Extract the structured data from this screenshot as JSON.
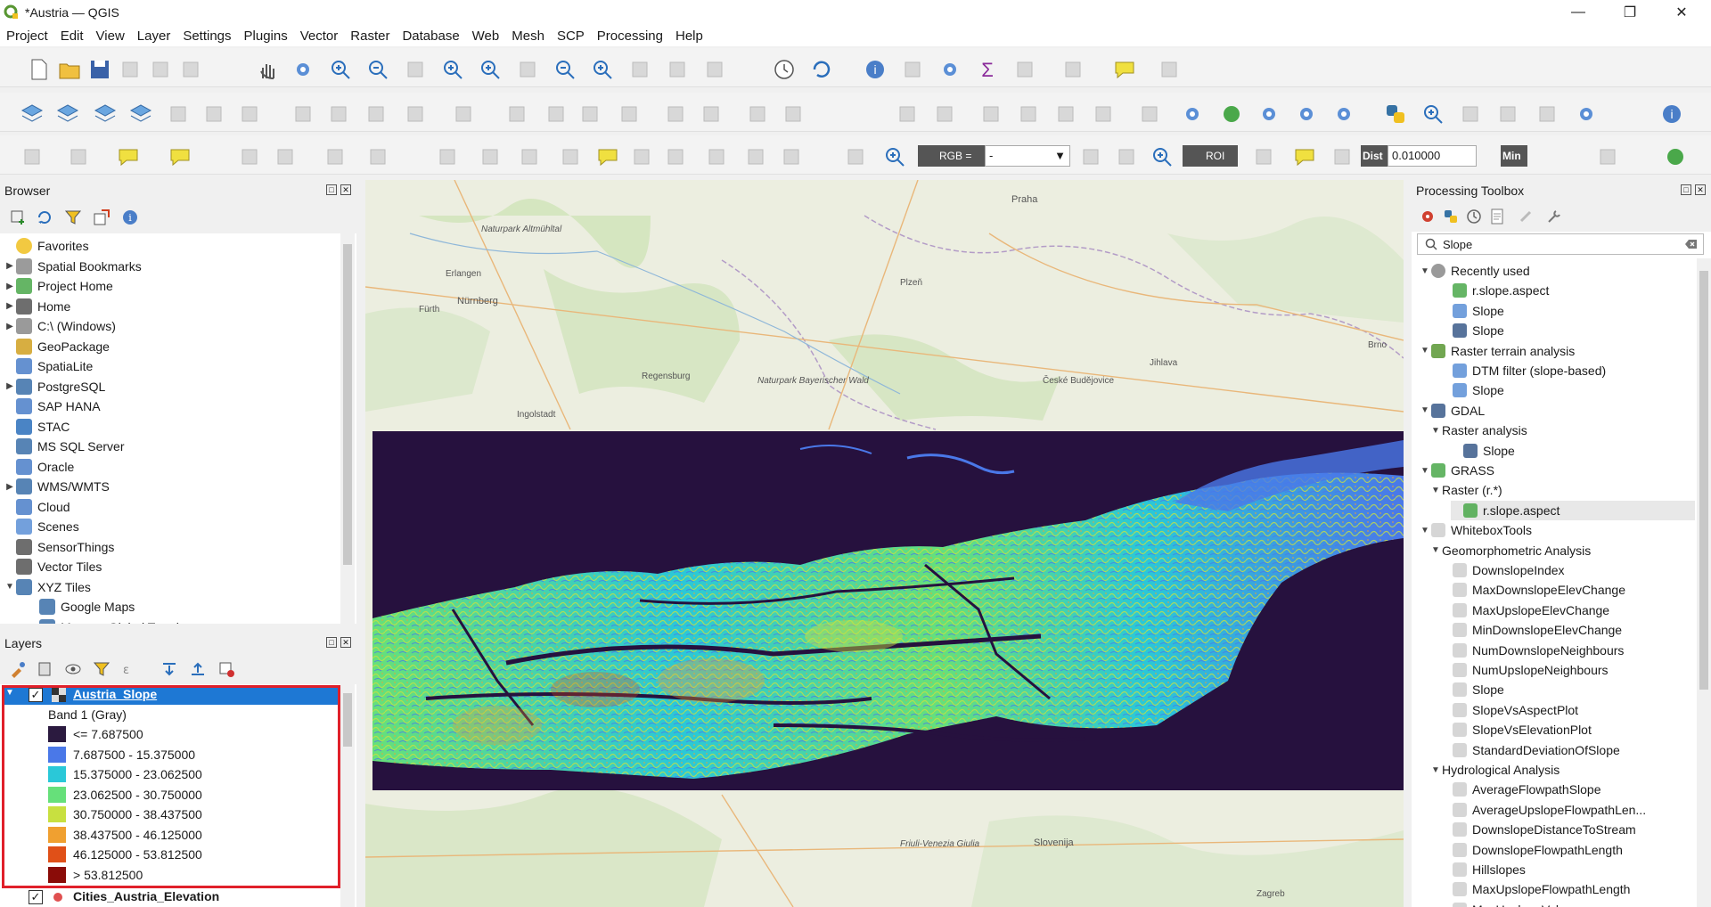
{
  "window": {
    "title": "*Austria — QGIS"
  },
  "menu": [
    "Project",
    "Edit",
    "View",
    "Layer",
    "Settings",
    "Plugins",
    "Vector",
    "Raster",
    "Database",
    "Web",
    "Mesh",
    "SCP",
    "Processing",
    "Help"
  ],
  "toolbar3": {
    "rgb_label": "RGB =",
    "rgb_value": "-",
    "roi_label": "ROI",
    "dist_label": "Dist",
    "dist_value": "0.010000",
    "min_label": "Min"
  },
  "browser": {
    "title": "Browser",
    "items": [
      {
        "label": "Favorites",
        "icon": "star-icon",
        "arrow": ""
      },
      {
        "label": "Spatial Bookmarks",
        "icon": "bookmark-icon",
        "arrow": "▶"
      },
      {
        "label": "Project Home",
        "icon": "project-home-icon",
        "arrow": "▶"
      },
      {
        "label": "Home",
        "icon": "home-icon",
        "arrow": "▶"
      },
      {
        "label": "C:\\ (Windows)",
        "icon": "drive-icon",
        "arrow": "▶"
      },
      {
        "label": "GeoPackage",
        "icon": "geopackage-icon",
        "arrow": ""
      },
      {
        "label": "SpatiaLite",
        "icon": "spatialite-icon",
        "arrow": ""
      },
      {
        "label": "PostgreSQL",
        "icon": "postgresql-icon",
        "arrow": "▶"
      },
      {
        "label": "SAP HANA",
        "icon": "sap-hana-icon",
        "arrow": ""
      },
      {
        "label": "STAC",
        "icon": "stac-icon",
        "arrow": ""
      },
      {
        "label": "MS SQL Server",
        "icon": "mssql-icon",
        "arrow": ""
      },
      {
        "label": "Oracle",
        "icon": "oracle-icon",
        "arrow": ""
      },
      {
        "label": "WMS/WMTS",
        "icon": "wms-icon",
        "arrow": "▶"
      },
      {
        "label": "Cloud",
        "icon": "cloud-icon",
        "arrow": ""
      },
      {
        "label": "Scenes",
        "icon": "scenes-icon",
        "arrow": ""
      },
      {
        "label": "SensorThings",
        "icon": "sensorthings-icon",
        "arrow": ""
      },
      {
        "label": "Vector Tiles",
        "icon": "vector-tiles-icon",
        "arrow": ""
      },
      {
        "label": "XYZ Tiles",
        "icon": "xyz-tiles-icon",
        "arrow": "▼"
      },
      {
        "label": "Google Maps",
        "icon": "xyz-tiles-icon",
        "arrow": ""
      },
      {
        "label": "Mapzen Global Terrain",
        "icon": "xyz-tiles-icon",
        "arrow": ""
      }
    ]
  },
  "layers": {
    "title": "Layers",
    "active_layer": "Austria_Slope",
    "band_label": "Band 1 (Gray)",
    "classes": [
      {
        "label": "<= 7.687500",
        "color": "#2b1a3f"
      },
      {
        "label": "7.687500 - 15.375000",
        "color": "#4a78e8"
      },
      {
        "label": "15.375000 - 23.062500",
        "color": "#2ac8d8"
      },
      {
        "label": "23.062500 - 30.750000",
        "color": "#66e07a"
      },
      {
        "label": "30.750000 - 38.437500",
        "color": "#c8e040"
      },
      {
        "label": "38.437500 - 46.125000",
        "color": "#f0a030"
      },
      {
        "label": "46.125000 - 53.812500",
        "color": "#e05018"
      },
      {
        "label": "> 53.812500",
        "color": "#8a0c08"
      }
    ],
    "second_layer": "Cities_Austria_Elevation"
  },
  "processing": {
    "title": "Processing Toolbox",
    "search_value": "Slope",
    "tree": [
      {
        "label": "Recently used",
        "indent": 0,
        "arrow": "▼",
        "icon": "clock-icon"
      },
      {
        "label": "r.slope.aspect",
        "indent": 2,
        "arrow": "",
        "icon": "grass-icon"
      },
      {
        "label": "Slope",
        "indent": 2,
        "arrow": "",
        "icon": "gear-icon"
      },
      {
        "label": "Slope",
        "indent": 2,
        "arrow": "",
        "icon": "gdal-icon"
      },
      {
        "label": "Raster terrain analysis",
        "indent": 0,
        "arrow": "▼",
        "icon": "qgis-icon"
      },
      {
        "label": "DTM filter (slope-based)",
        "indent": 2,
        "arrow": "",
        "icon": "gear-icon"
      },
      {
        "label": "Slope",
        "indent": 2,
        "arrow": "",
        "icon": "gear-icon"
      },
      {
        "label": "GDAL",
        "indent": 0,
        "arrow": "▼",
        "icon": "gdal-icon"
      },
      {
        "label": "Raster analysis",
        "indent": 1,
        "arrow": "▼",
        "icon": ""
      },
      {
        "label": "Slope",
        "indent": 3,
        "arrow": "",
        "icon": "gdal-icon"
      },
      {
        "label": "GRASS",
        "indent": 0,
        "arrow": "▼",
        "icon": "grass-icon"
      },
      {
        "label": "Raster (r.*)",
        "indent": 1,
        "arrow": "▼",
        "icon": ""
      },
      {
        "label": "r.slope.aspect",
        "indent": 3,
        "arrow": "",
        "icon": "grass-icon"
      },
      {
        "label": "WhiteboxTools",
        "indent": 0,
        "arrow": "▼",
        "icon": "cube-icon"
      },
      {
        "label": "Geomorphometric Analysis",
        "indent": 1,
        "arrow": "▼",
        "icon": ""
      },
      {
        "label": "DownslopeIndex",
        "indent": 2,
        "arrow": "",
        "icon": "cube-icon"
      },
      {
        "label": "MaxDownslopeElevChange",
        "indent": 2,
        "arrow": "",
        "icon": "cube-icon"
      },
      {
        "label": "MaxUpslopeElevChange",
        "indent": 2,
        "arrow": "",
        "icon": "cube-icon"
      },
      {
        "label": "MinDownslopeElevChange",
        "indent": 2,
        "arrow": "",
        "icon": "cube-icon"
      },
      {
        "label": "NumDownslopeNeighbours",
        "indent": 2,
        "arrow": "",
        "icon": "cube-icon"
      },
      {
        "label": "NumUpslopeNeighbours",
        "indent": 2,
        "arrow": "",
        "icon": "cube-icon"
      },
      {
        "label": "Slope",
        "indent": 2,
        "arrow": "",
        "icon": "cube-icon"
      },
      {
        "label": "SlopeVsAspectPlot",
        "indent": 2,
        "arrow": "",
        "icon": "cube-icon"
      },
      {
        "label": "SlopeVsElevationPlot",
        "indent": 2,
        "arrow": "",
        "icon": "cube-icon"
      },
      {
        "label": "StandardDeviationOfSlope",
        "indent": 2,
        "arrow": "",
        "icon": "cube-icon"
      },
      {
        "label": "Hydrological Analysis",
        "indent": 1,
        "arrow": "▼",
        "icon": ""
      },
      {
        "label": "AverageFlowpathSlope",
        "indent": 2,
        "arrow": "",
        "icon": "cube-icon"
      },
      {
        "label": "AverageUpslopeFlowpathLen...",
        "indent": 2,
        "arrow": "",
        "icon": "cube-icon"
      },
      {
        "label": "DownslopeDistanceToStream",
        "indent": 2,
        "arrow": "",
        "icon": "cube-icon"
      },
      {
        "label": "DownslopeFlowpathLength",
        "indent": 2,
        "arrow": "",
        "icon": "cube-icon"
      },
      {
        "label": "Hillslopes",
        "indent": 2,
        "arrow": "",
        "icon": "cube-icon"
      },
      {
        "label": "MaxUpslopeFlowpathLength",
        "indent": 2,
        "arrow": "",
        "icon": "cube-icon"
      },
      {
        "label": "MaxUpslopeValue",
        "indent": 2,
        "arrow": "",
        "icon": "cube-icon"
      }
    ]
  },
  "map_labels": [
    "Nürnberg",
    "Praha",
    "Ingolstadt",
    "Regensburg",
    "Brno",
    "Slovenija",
    "Zagreb",
    "Friuli-Venezia Giulia",
    "Naturpark Altmühltal",
    "Naturpark Bayerischer Wald",
    "České Budějovice",
    "Erlangen",
    "Plzeň",
    "Jihlava",
    "Fürth"
  ]
}
